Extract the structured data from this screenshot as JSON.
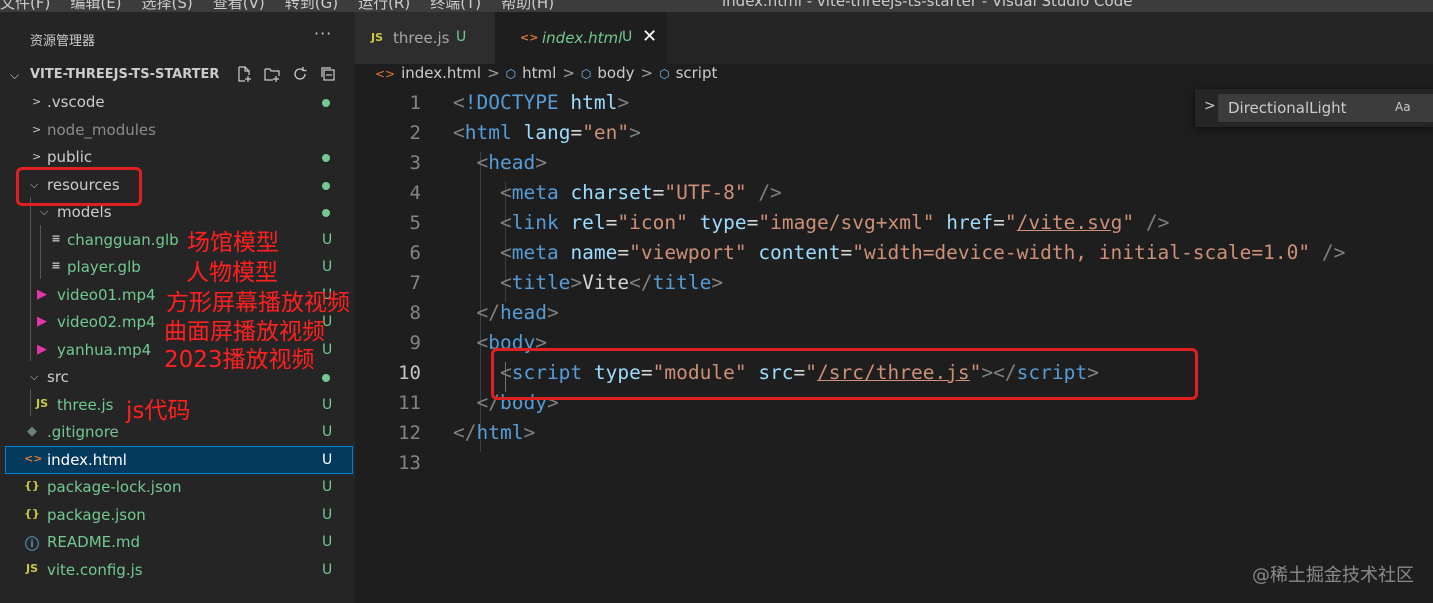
{
  "menubar": {
    "items": [
      "文件(F)",
      "编辑(E)",
      "选择(S)",
      "查看(V)",
      "转到(G)",
      "运行(R)",
      "终端(T)",
      "帮助(H)"
    ],
    "window_title": "index.html - vite-threejs-ts-starter - Visual Studio Code"
  },
  "explorer": {
    "header": "资源管理器",
    "more": "···",
    "root": "VITE-THREEJS-TS-STARTER",
    "items": [
      {
        "label": ".vscode",
        "status": ""
      },
      {
        "label": "node_modules",
        "status": ""
      },
      {
        "label": "public",
        "status": ""
      },
      {
        "label": "resources",
        "status": ""
      },
      {
        "label": "models",
        "status": ""
      },
      {
        "label": "changguan.glb",
        "status": "U"
      },
      {
        "label": "player.glb",
        "status": "U"
      },
      {
        "label": "video01.mp4",
        "status": "U"
      },
      {
        "label": "video02.mp4",
        "status": "U"
      },
      {
        "label": "yanhua.mp4",
        "status": "U"
      },
      {
        "label": "src",
        "status": ""
      },
      {
        "label": "three.js",
        "status": "U",
        "icon": "JS"
      },
      {
        "label": ".gitignore",
        "status": "U"
      },
      {
        "label": "index.html",
        "status": "U"
      },
      {
        "label": "package-lock.json",
        "status": "U",
        "icon": "{}"
      },
      {
        "label": "package.json",
        "status": "U",
        "icon": "{}"
      },
      {
        "label": "README.md",
        "status": "U"
      },
      {
        "label": "vite.config.js",
        "status": "U",
        "icon": "JS"
      }
    ]
  },
  "annotations": {
    "changguan": "场馆模型",
    "player": "人物模型",
    "video01": "方形屏幕播放视频",
    "video02": "曲面屏播放视频",
    "yanhua": "2023播放视频",
    "threejs": "js代码"
  },
  "tabs": [
    {
      "icon": "JS",
      "label": "three.js",
      "status": "U"
    },
    {
      "icon": "<>",
      "label": "index.html",
      "status": "U",
      "close": "✕"
    }
  ],
  "breadcrumb": [
    "index.html",
    "html",
    "body",
    "script"
  ],
  "find_widget": {
    "value": "DirectionalLight",
    "case_toggle": "Aa"
  },
  "code": {
    "line_numbers": [
      "1",
      "2",
      "3",
      "4",
      "5",
      "6",
      "7",
      "8",
      "9",
      "10",
      "11",
      "12",
      "13"
    ],
    "l1_decl": "!DOCTYPE",
    "l1_html": "html",
    "tag_html": "html",
    "attr_lang": "lang",
    "val_en": "\"en\"",
    "tag_head": "head",
    "tag_meta": "meta",
    "attr_charset": "charset",
    "val_utf8": "\"UTF-8\"",
    "tag_link": "link",
    "attr_rel": "rel",
    "val_icon": "\"icon\"",
    "attr_type": "type",
    "val_svg": "\"image/svg+xml\"",
    "attr_href": "href",
    "val_href": "/vite.svg",
    "attr_name": "name",
    "val_viewport": "\"viewport\"",
    "attr_content": "content",
    "val_content": "\"width=device-width, initial-scale=1.0\"",
    "tag_title": "title",
    "title_text": "Vite",
    "tag_body": "body",
    "tag_script": "script",
    "val_module": "\"module\"",
    "attr_src": "src",
    "val_src": "/src/three.js"
  },
  "watermark": "@稀土掘金技术社区",
  "colors": {
    "editor_bg": "#1e1e1e",
    "sidebar_bg": "#252526",
    "untracked_green": "#73c991",
    "annotation_red": "#ff2020",
    "tag_blue": "#569cd6",
    "attr_lightblue": "#9cdcfe",
    "string_orange": "#ce9178"
  }
}
